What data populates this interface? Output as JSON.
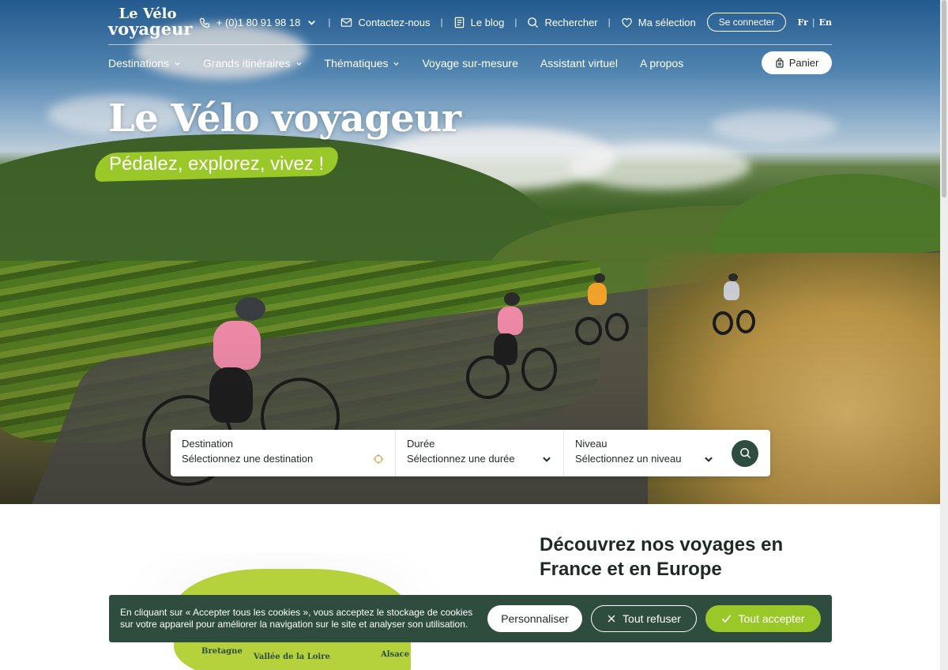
{
  "brand": {
    "line1": "Le Vélo",
    "line2": "voyageur"
  },
  "toplinks": {
    "phone": "+ (0)1 80 91 98 18",
    "contact": "Contactez-nous",
    "blog": "Le blog",
    "search": "Rechercher",
    "selection": "Ma sélection",
    "login": "Se connecter",
    "lang_fr": "Fr",
    "lang_sep": "|",
    "lang_en": "En"
  },
  "nav": {
    "items": [
      {
        "label": "Destinations",
        "dropdown": true
      },
      {
        "label": "Grands itinéraires",
        "dropdown": true
      },
      {
        "label": "Thématiques",
        "dropdown": true
      },
      {
        "label": "Voyage sur-mesure",
        "dropdown": false
      },
      {
        "label": "Assistant virtuel",
        "dropdown": false
      },
      {
        "label": "A propos",
        "dropdown": false
      }
    ],
    "cart": "Panier"
  },
  "hero": {
    "title": "Le Vélo voyageur",
    "subtitle": "Pédalez, explorez, vivez !"
  },
  "search": {
    "destination": {
      "label": "Destination",
      "placeholder": "Sélectionnez une destination"
    },
    "duration": {
      "label": "Durée",
      "placeholder": "Sélectionnez une durée"
    },
    "level": {
      "label": "Niveau",
      "placeholder": "Sélectionnez un niveau"
    }
  },
  "discover": {
    "title": "Découvrez nos voyages en France et en Europe"
  },
  "map": {
    "labels": [
      "Bretagne",
      "Vallée de la Loire",
      "Alsace"
    ]
  },
  "cookie": {
    "text": "En cliquant sur « Accepter tous les cookies », vous acceptez le stockage de cookies sur votre appareil pour améliorer la navigation sur le site et analyser son utilisation.",
    "customize": "Personnaliser",
    "refuse": "Tout refuser",
    "accept": "Tout accepter"
  },
  "colors": {
    "brand_green": "#2e4d3f",
    "accent_lime": "#9bc829",
    "map_green": "#b5d13b"
  },
  "icons": [
    "phone-icon",
    "mail-icon",
    "blog-icon",
    "search-icon",
    "heart-icon",
    "chevron-down-icon",
    "cart-icon",
    "location-target-icon",
    "close-icon",
    "check-icon"
  ]
}
